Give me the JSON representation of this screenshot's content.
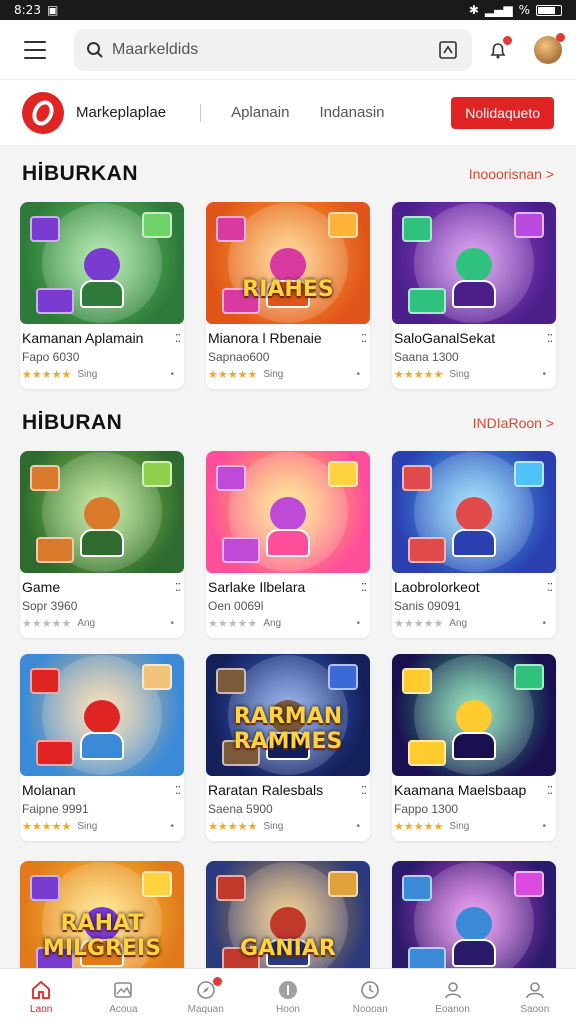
{
  "status_bar": {
    "time": "8:23",
    "right_text": "%"
  },
  "search": {
    "placeholder": "Maarkeldids",
    "value": "Maarkeldids"
  },
  "brand": {
    "name": "Markeplaplae",
    "links": [
      "Aplanain",
      "Indanasin"
    ],
    "cta_label": "Nolidaqueto"
  },
  "sections": [
    {
      "title": "HİBURKAN",
      "link": "Inooorisnan >",
      "cards": [
        {
          "name": "Kamanan Aplamain",
          "sub": "Fapo 6030",
          "rating": 4.5,
          "rating_label": "Sing",
          "theme": "green"
        },
        {
          "name": "Mianora l Rbenaie",
          "sub": "Sapnao600",
          "rating": 4.5,
          "rating_label": "Sing",
          "theme": "orange",
          "art": "RIAHES"
        },
        {
          "name": "SaloGanalSekat",
          "sub": "Saana 1300",
          "rating": 4.5,
          "rating_label": "Sing",
          "theme": "purple"
        }
      ]
    },
    {
      "title": "HİBURAN",
      "link": "INDIaRoon >",
      "cards": [
        {
          "name": "Game",
          "sub": "Sopr 3960",
          "rating": 0,
          "rating_label": "Ang",
          "theme": "green2"
        },
        {
          "name": "Sarlake Ilbelara",
          "sub": "Oen 0069l",
          "rating": 0,
          "rating_label": "Ang",
          "theme": "pink"
        },
        {
          "name": "Laobrolorkeot",
          "sub": "Sanis 09091",
          "rating": 0,
          "rating_label": "Ang",
          "theme": "blue"
        }
      ]
    },
    {
      "title": "",
      "link": "",
      "cards": [
        {
          "name": "Molanan",
          "sub": "Faipne 9991",
          "rating": 4.5,
          "rating_label": "Sing",
          "theme": "sky"
        },
        {
          "name": "Raratan Ralesbals",
          "sub": "Saena 5900",
          "rating": 4.5,
          "rating_label": "Sing",
          "theme": "navy",
          "art": "RARMAN RAMMES"
        },
        {
          "name": "Kaamana Maelsbaap",
          "sub": "Fappo 1300",
          "rating": 4.5,
          "rating_label": "Sing",
          "theme": "night"
        }
      ]
    },
    {
      "title": "",
      "link": "",
      "cards": [
        {
          "name": "",
          "sub": "",
          "rating": 0,
          "rating_label": "",
          "theme": "sunset",
          "art": "RAHAT MILGREIS"
        },
        {
          "name": "",
          "sub": "",
          "rating": 0,
          "rating_label": "",
          "theme": "city",
          "art": "GANIAR"
        },
        {
          "name": "",
          "sub": "",
          "rating": 0,
          "rating_label": "",
          "theme": "violet"
        }
      ]
    }
  ],
  "bottom_nav": [
    {
      "label": "Laon",
      "icon": "home-icon",
      "active": true
    },
    {
      "label": "Acoua",
      "icon": "image-icon",
      "active": false
    },
    {
      "label": "Maquan",
      "icon": "compass-icon",
      "active": false
    },
    {
      "label": "Hoon",
      "icon": "circle-icon",
      "active": false
    },
    {
      "label": "Noooan",
      "icon": "clock-icon",
      "active": false
    },
    {
      "label": "Eoanon",
      "icon": "user-icon",
      "active": false
    },
    {
      "label": "Saoon",
      "icon": "profile-icon",
      "active": false
    }
  ],
  "colors": {
    "accent": "#e02424",
    "link": "#e0452c",
    "star": "#f5a623"
  }
}
